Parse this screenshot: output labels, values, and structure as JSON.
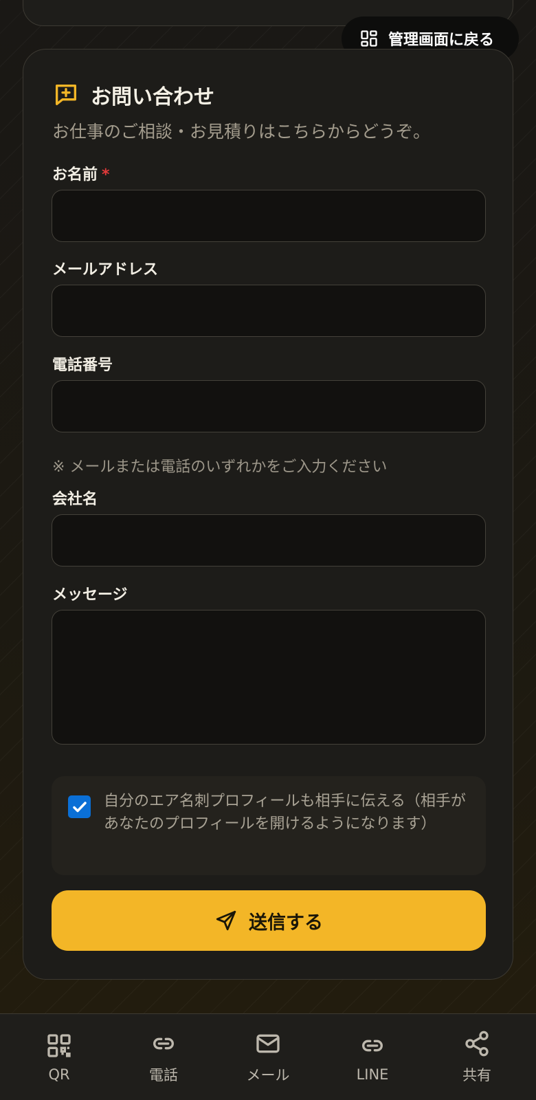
{
  "admin_button": {
    "label": "管理画面に戻る",
    "icon": "grid-icon"
  },
  "contact": {
    "title": "お問い合わせ",
    "subtitle": "お仕事のご相談・お見積りはこちらからどうぞ。",
    "required_mark": "*",
    "fields": {
      "name": {
        "label": "お名前",
        "value": "",
        "placeholder": ""
      },
      "email": {
        "label": "メールアドレス",
        "value": "",
        "placeholder": ""
      },
      "phone": {
        "label": "電話番号",
        "value": "",
        "placeholder": ""
      },
      "company": {
        "label": "会社名",
        "value": "",
        "placeholder": ""
      },
      "message": {
        "label": "メッセージ",
        "value": "",
        "placeholder": ""
      }
    },
    "note": "※ メールまたは電話のいずれかをご入力ください",
    "consent": {
      "checked": true,
      "text": "自分のエア名刺プロフィールも相手に伝える（相手があなたのプロフィールを開けるようになります）"
    },
    "submit_label": "送信する"
  },
  "bottom_nav": {
    "items": [
      {
        "label": "QR",
        "icon": "qr-code-icon"
      },
      {
        "label": "電話",
        "icon": "link-icon"
      },
      {
        "label": "メール",
        "icon": "mail-icon"
      },
      {
        "label": "LINE",
        "icon": "link-icon"
      },
      {
        "label": "共有",
        "icon": "share-icon"
      }
    ]
  },
  "colors": {
    "accent": "#f3b627",
    "checkbox": "#0a6fd6",
    "required": "#e23a3a",
    "background": "#1b1813"
  }
}
